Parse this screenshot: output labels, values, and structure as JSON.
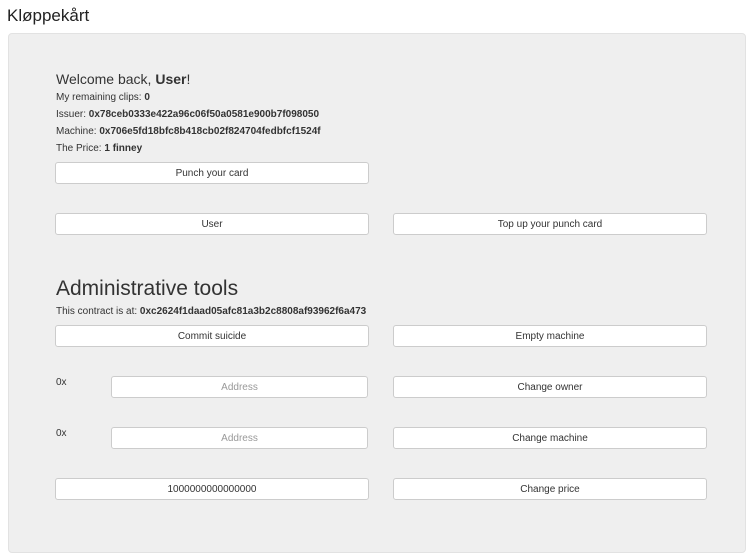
{
  "app": {
    "title": "Kløppekårt"
  },
  "welcome": {
    "greeting": "Welcome back, ",
    "user": "User",
    "suffix": "!"
  },
  "info": {
    "clips_label": "My remaining clips: ",
    "clips_value": "0",
    "issuer_label": "Issuer: ",
    "issuer_value": "0x78ceb0333e422a96c06f50a0581e900b7f098050",
    "machine_label": "Machine: ",
    "machine_value": "0x706e5fd18bfc8b418cb02f824704fedbfcf1524f",
    "price_label": "The Price: ",
    "price_value": "1 finney"
  },
  "buttons": {
    "punch": "Punch your card",
    "user": "User",
    "top_up": "Top up your punch card",
    "commit_suicide": "Commit suicide",
    "empty_machine": "Empty machine",
    "change_owner": "Change owner",
    "change_machine": "Change machine",
    "change_price": "Change price"
  },
  "admin": {
    "title": "Administrative tools",
    "contract_label": "This contract is at: ",
    "contract_value": "0xc2624f1daad05afc81a3b2c8808af93962f6a473"
  },
  "owner_row": {
    "prefix": "0x",
    "placeholder": "Address"
  },
  "machine_row": {
    "prefix": "0x",
    "placeholder": "Address"
  },
  "price_input": {
    "value": "1000000000000000"
  }
}
